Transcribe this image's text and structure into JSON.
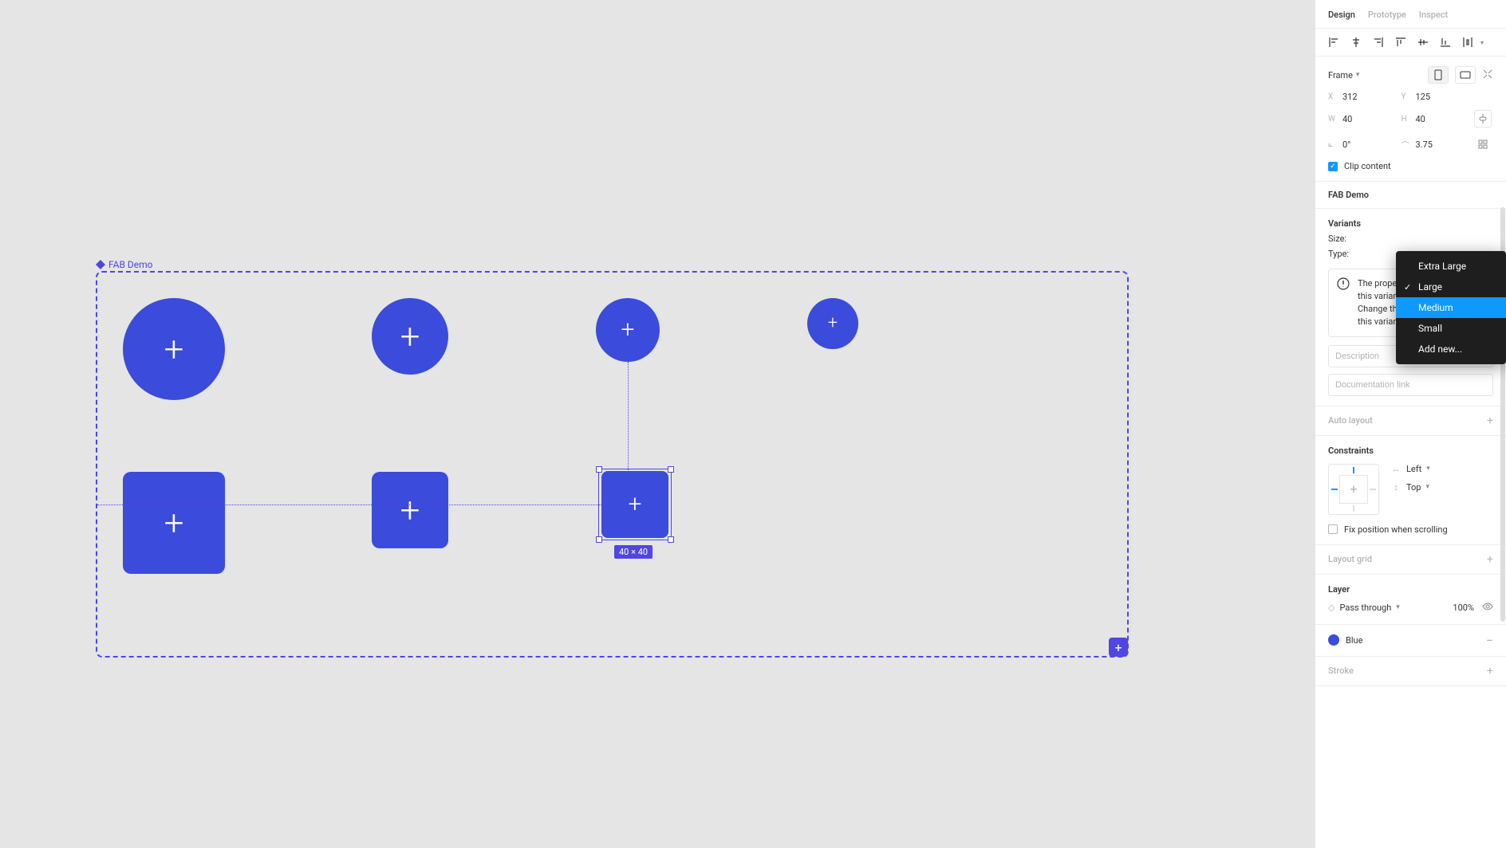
{
  "canvas": {
    "component_label": "FAB Demo",
    "selection_dim": "40 × 40"
  },
  "tabs": [
    "Design",
    "Prototype",
    "Inspect"
  ],
  "active_tab": 0,
  "frame": {
    "type": "Frame",
    "x_label": "X",
    "x": "312",
    "y_label": "Y",
    "y": "125",
    "w_label": "W",
    "w": "40",
    "h_label": "H",
    "h": "40",
    "rotation": "0°",
    "radius": "3.75",
    "clip_content": "Clip content"
  },
  "component_section": {
    "title": "FAB Demo"
  },
  "variants": {
    "title": "Variants",
    "size_label": "Size:",
    "type_label": "Type:",
    "dropdown_items": [
      "Extra Large",
      "Large",
      "Medium",
      "Small",
      "Add new..."
    ],
    "dropdown_checked": 1,
    "dropdown_highlighted": 2,
    "warning": "The properties and values of this variant are conflicting. Change the applied values on this variant to resolve this.",
    "description_ph": "Description",
    "doc_link_ph": "Documentation link"
  },
  "auto_layout": {
    "title": "Auto layout"
  },
  "constraints": {
    "title": "Constraints",
    "h": "Left",
    "v": "Top",
    "fix_position": "Fix position when scrolling"
  },
  "layout_grid": {
    "title": "Layout grid"
  },
  "layer": {
    "title": "Layer",
    "mode": "Pass through",
    "opacity": "100%"
  },
  "fill": {
    "name": "Blue",
    "color": "#3b4bdb"
  },
  "stroke": {
    "title": "Stroke"
  }
}
